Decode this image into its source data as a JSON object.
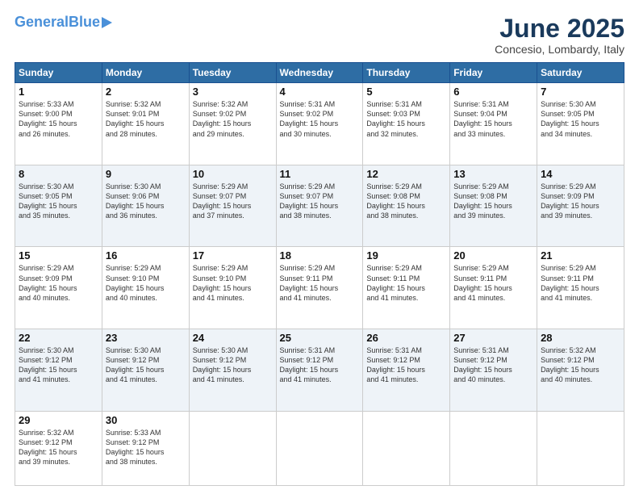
{
  "header": {
    "logo_line1": "General",
    "logo_line2": "Blue",
    "month": "June 2025",
    "location": "Concesio, Lombardy, Italy"
  },
  "days_of_week": [
    "Sunday",
    "Monday",
    "Tuesday",
    "Wednesday",
    "Thursday",
    "Friday",
    "Saturday"
  ],
  "weeks": [
    [
      {
        "day": "1",
        "lines": [
          "Sunrise: 5:33 AM",
          "Sunset: 9:00 PM",
          "Daylight: 15 hours",
          "and 26 minutes."
        ]
      },
      {
        "day": "2",
        "lines": [
          "Sunrise: 5:32 AM",
          "Sunset: 9:01 PM",
          "Daylight: 15 hours",
          "and 28 minutes."
        ]
      },
      {
        "day": "3",
        "lines": [
          "Sunrise: 5:32 AM",
          "Sunset: 9:02 PM",
          "Daylight: 15 hours",
          "and 29 minutes."
        ]
      },
      {
        "day": "4",
        "lines": [
          "Sunrise: 5:31 AM",
          "Sunset: 9:02 PM",
          "Daylight: 15 hours",
          "and 30 minutes."
        ]
      },
      {
        "day": "5",
        "lines": [
          "Sunrise: 5:31 AM",
          "Sunset: 9:03 PM",
          "Daylight: 15 hours",
          "and 32 minutes."
        ]
      },
      {
        "day": "6",
        "lines": [
          "Sunrise: 5:31 AM",
          "Sunset: 9:04 PM",
          "Daylight: 15 hours",
          "and 33 minutes."
        ]
      },
      {
        "day": "7",
        "lines": [
          "Sunrise: 5:30 AM",
          "Sunset: 9:05 PM",
          "Daylight: 15 hours",
          "and 34 minutes."
        ]
      }
    ],
    [
      {
        "day": "8",
        "lines": [
          "Sunrise: 5:30 AM",
          "Sunset: 9:05 PM",
          "Daylight: 15 hours",
          "and 35 minutes."
        ]
      },
      {
        "day": "9",
        "lines": [
          "Sunrise: 5:30 AM",
          "Sunset: 9:06 PM",
          "Daylight: 15 hours",
          "and 36 minutes."
        ]
      },
      {
        "day": "10",
        "lines": [
          "Sunrise: 5:29 AM",
          "Sunset: 9:07 PM",
          "Daylight: 15 hours",
          "and 37 minutes."
        ]
      },
      {
        "day": "11",
        "lines": [
          "Sunrise: 5:29 AM",
          "Sunset: 9:07 PM",
          "Daylight: 15 hours",
          "and 38 minutes."
        ]
      },
      {
        "day": "12",
        "lines": [
          "Sunrise: 5:29 AM",
          "Sunset: 9:08 PM",
          "Daylight: 15 hours",
          "and 38 minutes."
        ]
      },
      {
        "day": "13",
        "lines": [
          "Sunrise: 5:29 AM",
          "Sunset: 9:08 PM",
          "Daylight: 15 hours",
          "and 39 minutes."
        ]
      },
      {
        "day": "14",
        "lines": [
          "Sunrise: 5:29 AM",
          "Sunset: 9:09 PM",
          "Daylight: 15 hours",
          "and 39 minutes."
        ]
      }
    ],
    [
      {
        "day": "15",
        "lines": [
          "Sunrise: 5:29 AM",
          "Sunset: 9:09 PM",
          "Daylight: 15 hours",
          "and 40 minutes."
        ]
      },
      {
        "day": "16",
        "lines": [
          "Sunrise: 5:29 AM",
          "Sunset: 9:10 PM",
          "Daylight: 15 hours",
          "and 40 minutes."
        ]
      },
      {
        "day": "17",
        "lines": [
          "Sunrise: 5:29 AM",
          "Sunset: 9:10 PM",
          "Daylight: 15 hours",
          "and 41 minutes."
        ]
      },
      {
        "day": "18",
        "lines": [
          "Sunrise: 5:29 AM",
          "Sunset: 9:11 PM",
          "Daylight: 15 hours",
          "and 41 minutes."
        ]
      },
      {
        "day": "19",
        "lines": [
          "Sunrise: 5:29 AM",
          "Sunset: 9:11 PM",
          "Daylight: 15 hours",
          "and 41 minutes."
        ]
      },
      {
        "day": "20",
        "lines": [
          "Sunrise: 5:29 AM",
          "Sunset: 9:11 PM",
          "Daylight: 15 hours",
          "and 41 minutes."
        ]
      },
      {
        "day": "21",
        "lines": [
          "Sunrise: 5:29 AM",
          "Sunset: 9:11 PM",
          "Daylight: 15 hours",
          "and 41 minutes."
        ]
      }
    ],
    [
      {
        "day": "22",
        "lines": [
          "Sunrise: 5:30 AM",
          "Sunset: 9:12 PM",
          "Daylight: 15 hours",
          "and 41 minutes."
        ]
      },
      {
        "day": "23",
        "lines": [
          "Sunrise: 5:30 AM",
          "Sunset: 9:12 PM",
          "Daylight: 15 hours",
          "and 41 minutes."
        ]
      },
      {
        "day": "24",
        "lines": [
          "Sunrise: 5:30 AM",
          "Sunset: 9:12 PM",
          "Daylight: 15 hours",
          "and 41 minutes."
        ]
      },
      {
        "day": "25",
        "lines": [
          "Sunrise: 5:31 AM",
          "Sunset: 9:12 PM",
          "Daylight: 15 hours",
          "and 41 minutes."
        ]
      },
      {
        "day": "26",
        "lines": [
          "Sunrise: 5:31 AM",
          "Sunset: 9:12 PM",
          "Daylight: 15 hours",
          "and 41 minutes."
        ]
      },
      {
        "day": "27",
        "lines": [
          "Sunrise: 5:31 AM",
          "Sunset: 9:12 PM",
          "Daylight: 15 hours",
          "and 40 minutes."
        ]
      },
      {
        "day": "28",
        "lines": [
          "Sunrise: 5:32 AM",
          "Sunset: 9:12 PM",
          "Daylight: 15 hours",
          "and 40 minutes."
        ]
      }
    ],
    [
      {
        "day": "29",
        "lines": [
          "Sunrise: 5:32 AM",
          "Sunset: 9:12 PM",
          "Daylight: 15 hours",
          "and 39 minutes."
        ]
      },
      {
        "day": "30",
        "lines": [
          "Sunrise: 5:33 AM",
          "Sunset: 9:12 PM",
          "Daylight: 15 hours",
          "and 38 minutes."
        ]
      },
      {
        "day": "",
        "lines": []
      },
      {
        "day": "",
        "lines": []
      },
      {
        "day": "",
        "lines": []
      },
      {
        "day": "",
        "lines": []
      },
      {
        "day": "",
        "lines": []
      }
    ]
  ]
}
